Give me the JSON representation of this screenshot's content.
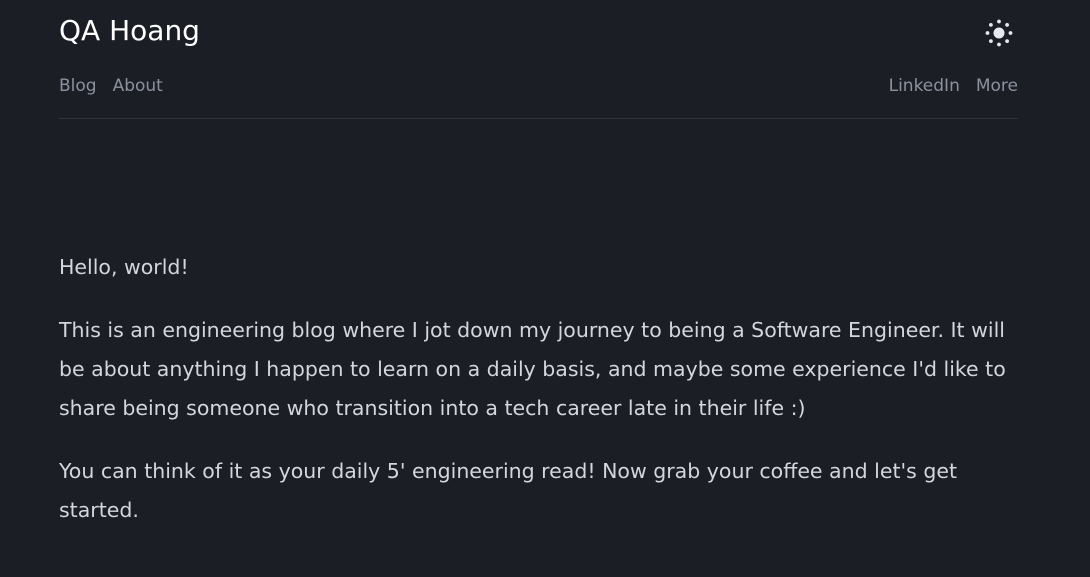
{
  "header": {
    "site_title": "QA Hoang",
    "theme_toggle_icon": "sun-icon"
  },
  "nav": {
    "left": [
      {
        "label": "Blog"
      },
      {
        "label": "About"
      }
    ],
    "right": [
      {
        "label": "LinkedIn"
      },
      {
        "label": "More"
      }
    ]
  },
  "main": {
    "paragraphs": [
      "Hello, world!",
      "This is an engineering blog where I jot down my journey to being a Software Engineer. It will be about anything I happen to learn on a daily basis, and maybe some experience I'd like to share being someone who transition into a tech career late in their life :)",
      "You can think of it as your daily 5' engineering read! Now grab your coffee and let's get started."
    ]
  },
  "colors": {
    "background": "#1c1e26",
    "title": "#ffffff",
    "nav_text": "#8c919d",
    "body_text": "#d3d6dd",
    "divider": "#2f323c"
  }
}
